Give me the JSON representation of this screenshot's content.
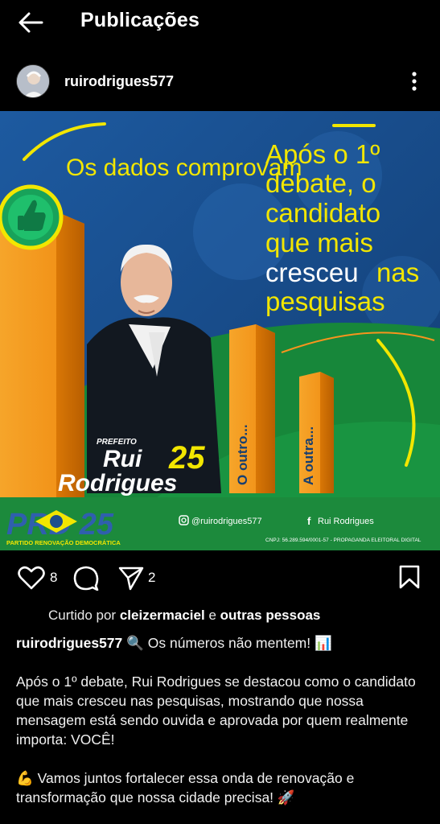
{
  "header": {
    "title": "Publicações"
  },
  "post": {
    "username": "ruirodrigues577",
    "image": {
      "left_heading": "Os dados comprovam",
      "right_heading_line1": "Após o 1º",
      "right_heading_line2": "debate, o",
      "right_heading_line3": "candidato",
      "right_heading_line4": "que mais",
      "right_heading_line5a": "cresceu",
      "right_heading_line5b": "nas",
      "right_heading_line6": "pesquisas",
      "bar2_label": "O outro...",
      "bar3_label": "A outra...",
      "prefeito": "PREFEITO",
      "name_first": "Rui",
      "name_last": "Rodrigues",
      "number": "25",
      "party_logo": "PRD 25",
      "party_name": "PARTIDO RENOVAÇÃO DEMOCRÁTICA",
      "instagram_handle": "@ruirodrigues577",
      "facebook_name": "Rui Rodrigues",
      "cnpj": "CNPJ: 56.289.594/0001-57 - PROPAGANDA ELEITORAL DIGITAL"
    },
    "likes_count": "8",
    "shares_count": "2",
    "liked_by_prefix": "Curtido por",
    "liked_by_user": "cleizermaciel",
    "liked_by_conj": "e",
    "liked_by_others": "outras pessoas",
    "caption_first": "🔍 Os números não mentem! 📊",
    "caption_p2": "Após o 1º debate, Rui Rodrigues se destacou como o candidato que mais cresceu nas pesquisas, mostrando que nossa mensagem está sendo ouvida e aprovada por quem realmente importa: VOCÊ!",
    "caption_p3": "💪 Vamos juntos fortalecer essa onda de renovação e transformação que nossa cidade precisa! 🚀"
  },
  "colors": {
    "background": "#000000",
    "banner_blue": "#1d4f8c",
    "banner_green": "#1a8a3a",
    "accent_yellow": "#f2e600",
    "bar_orange": "#f7941d"
  }
}
